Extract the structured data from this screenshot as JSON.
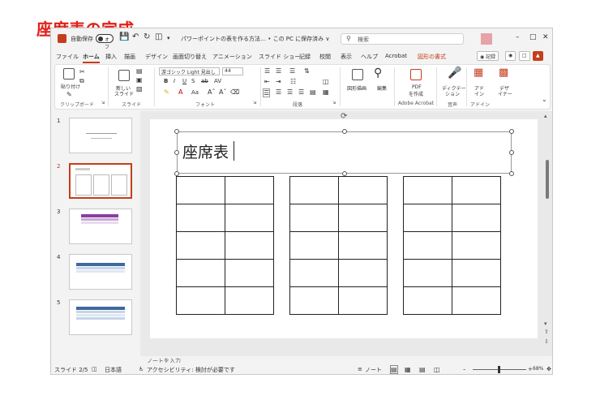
{
  "headline": "座席表の完成",
  "titlebar": {
    "autosave_label": "自動保存",
    "autosave_state": "オフ",
    "undo_icon": "undo-icon",
    "doc_title": "パワーポイントの表を作る方法… • この PC に保存済み ∨",
    "search_placeholder": "検索"
  },
  "tabs": [
    {
      "label": "ファイル"
    },
    {
      "label": "ホーム"
    },
    {
      "label": "挿入"
    },
    {
      "label": "描画"
    },
    {
      "label": "デザイン"
    },
    {
      "label": "画面切り替え"
    },
    {
      "label": "アニメーション"
    },
    {
      "label": "スライド ショー"
    },
    {
      "label": "記録"
    },
    {
      "label": "校閲"
    },
    {
      "label": "表示"
    },
    {
      "label": "ヘルプ"
    },
    {
      "label": "Acrobat"
    },
    {
      "label": "図形の書式"
    }
  ],
  "record_button": "◉ 記録",
  "ribbon": {
    "paste": "貼り付け",
    "new_slide_1": "新しい",
    "new_slide_2": "スライド",
    "font_name": "游ゴシック Light 見出し",
    "font_size": "44",
    "shapes": "図形描画",
    "edit": "編集",
    "pdf_1": "PDF",
    "pdf_2": "を作成",
    "dictate_1": "ディクテー",
    "dictate_2": "ション",
    "addin_1": "アド",
    "addin_2": "イン",
    "designer_1": "デザ",
    "designer_2": "イナー",
    "groups": [
      "クリップボード",
      "スライド",
      "フォント",
      "段落",
      "Adobe Acrobat",
      "音声",
      "アドイン"
    ]
  },
  "slides": [
    {
      "num": "1"
    },
    {
      "num": "2"
    },
    {
      "num": "3"
    },
    {
      "num": "4"
    },
    {
      "num": "5"
    }
  ],
  "slide": {
    "title": "座席表",
    "rows": 5,
    "cols": 2,
    "tables": 3
  },
  "notes_placeholder": "ノートを入力",
  "status": {
    "slide_info": "スライド 2/5",
    "language": "日本語",
    "accessibility": "アクセシビリティ: 検討が必要です",
    "notes": "ノート",
    "zoom": "68%"
  },
  "colors": {
    "accent": "#c43e1c",
    "headline": "#e0201a"
  }
}
